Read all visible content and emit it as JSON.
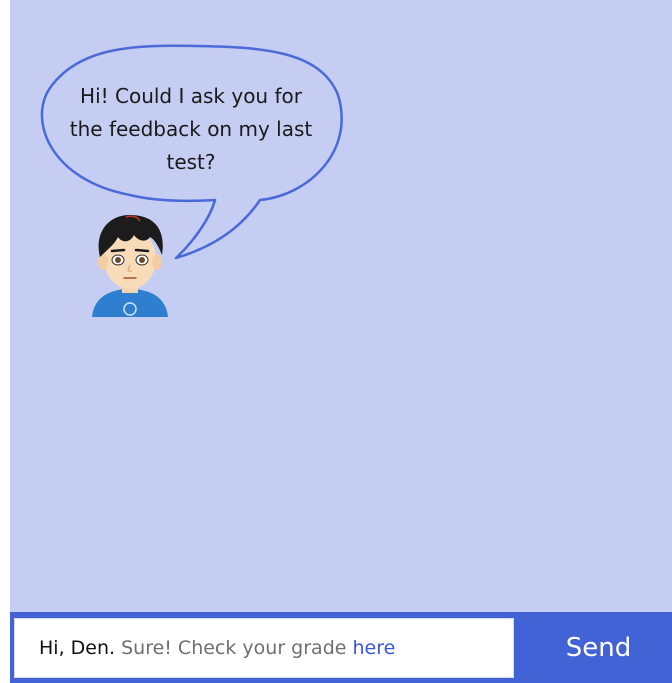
{
  "chat": {
    "incoming_message": "Hi! Could I ask you for the feedback on my last test?",
    "avatar_icon": "student-boy-avatar-icon"
  },
  "composer": {
    "greeting": "Hi, Den.",
    "reply_text": "Sure! Check your grade",
    "link_text": "here",
    "send_label": "Send"
  },
  "colors": {
    "chat_background": "#c6cdf3",
    "bubble_stroke": "#4a6ad8",
    "send_bar": "#4263d6",
    "link": "#3a57cf"
  }
}
